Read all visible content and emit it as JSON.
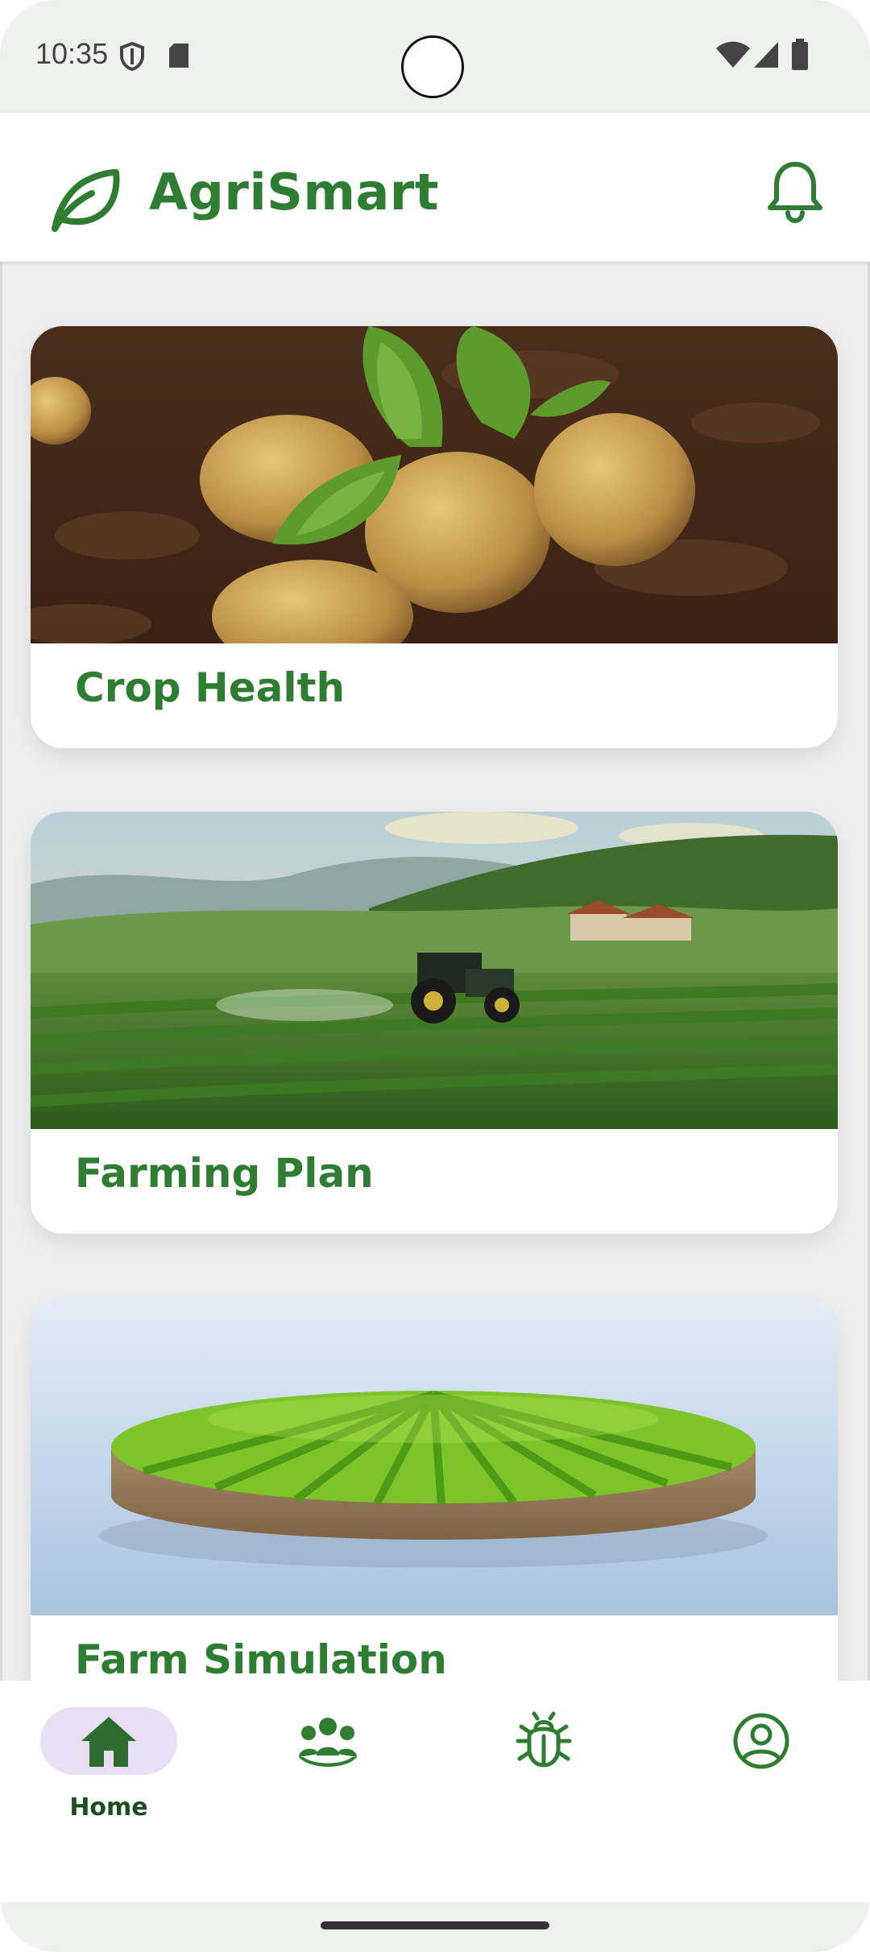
{
  "status_bar": {
    "time": "10:35"
  },
  "header": {
    "app_title": "AgriSmart",
    "logo_icon": "leaf-icon",
    "notification_icon": "bell-icon"
  },
  "cards": [
    {
      "title": "Crop Health",
      "image": "potatoes-in-soil-photo"
    },
    {
      "title": "Farming Plan",
      "image": "tractor-in-field-photo"
    },
    {
      "title": "Farm Simulation",
      "image": "farm-plot-3d-photo"
    }
  ],
  "bottom_nav": {
    "items": [
      {
        "label": "Home",
        "icon": "home-icon",
        "selected": true
      },
      {
        "label": "",
        "icon": "community-icon",
        "selected": false
      },
      {
        "label": "",
        "icon": "bug-icon",
        "selected": false
      },
      {
        "label": "",
        "icon": "account-icon",
        "selected": false
      }
    ]
  },
  "colors": {
    "brand_green": "#2e7d32",
    "nav_pill": "#e8dff5",
    "background": "#f0efef"
  }
}
